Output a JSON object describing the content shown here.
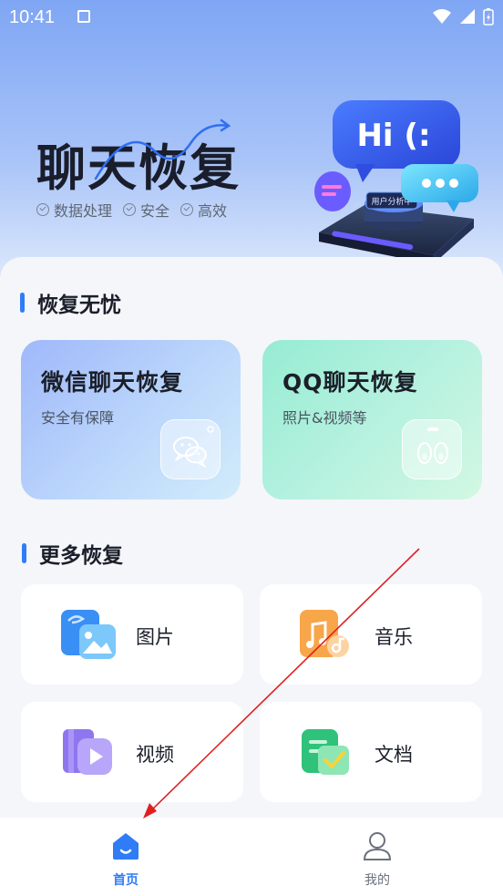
{
  "status_bar": {
    "time": "10:41"
  },
  "hero": {
    "title": "聊天恢复",
    "features": [
      "数据处理",
      "安全",
      "高效"
    ],
    "art_badge": "用户分析中",
    "art_bubble": "Hi (:"
  },
  "section_main": {
    "title": "恢复无忧"
  },
  "big_cards": [
    {
      "title": "微信聊天恢复",
      "subtitle": "安全有保障"
    },
    {
      "title": "QQ聊天恢复",
      "subtitle": "照片&视频等"
    }
  ],
  "section_more": {
    "title": "更多恢复"
  },
  "more_items": [
    {
      "label": "图片"
    },
    {
      "label": "音乐"
    },
    {
      "label": "视频"
    },
    {
      "label": "文档"
    }
  ],
  "bottom_nav": [
    {
      "label": "首页",
      "active": true
    },
    {
      "label": "我的",
      "active": false
    }
  ],
  "colors": {
    "accent": "#2f7cf6",
    "annotation": "#e02020"
  }
}
